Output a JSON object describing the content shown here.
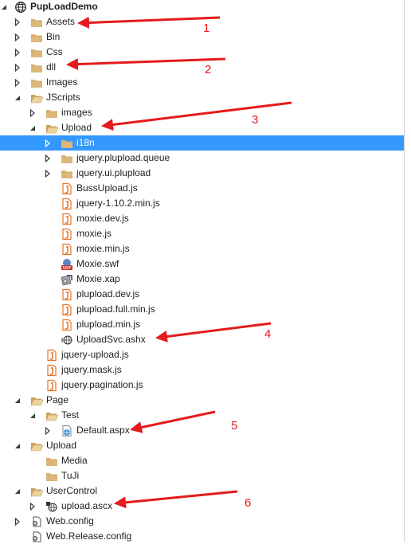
{
  "tree": {
    "items": [
      {
        "label": "PupLoadDemo",
        "depth": 0,
        "expander": "expanded",
        "icon": "web-project-icon",
        "bold": true
      },
      {
        "label": "Assets",
        "depth": 1,
        "expander": "collapsed",
        "icon": "folder-icon"
      },
      {
        "label": "Bin",
        "depth": 1,
        "expander": "collapsed",
        "icon": "folder-icon"
      },
      {
        "label": "Css",
        "depth": 1,
        "expander": "collapsed",
        "icon": "folder-icon"
      },
      {
        "label": "dll",
        "depth": 1,
        "expander": "collapsed",
        "icon": "folder-icon"
      },
      {
        "label": "Images",
        "depth": 1,
        "expander": "collapsed",
        "icon": "folder-icon"
      },
      {
        "label": "JScripts",
        "depth": 1,
        "expander": "expanded",
        "icon": "folder-open-icon"
      },
      {
        "label": "images",
        "depth": 2,
        "expander": "collapsed",
        "icon": "folder-icon"
      },
      {
        "label": "Upload",
        "depth": 2,
        "expander": "expanded",
        "icon": "folder-open-icon"
      },
      {
        "label": "i18n",
        "depth": 3,
        "expander": "collapsed",
        "icon": "folder-icon",
        "selected": true
      },
      {
        "label": "jquery.plupload.queue",
        "depth": 3,
        "expander": "collapsed",
        "icon": "folder-icon"
      },
      {
        "label": "jquery.ui.plupload",
        "depth": 3,
        "expander": "collapsed",
        "icon": "folder-icon"
      },
      {
        "label": "BussUpload.js",
        "depth": 3,
        "expander": "none",
        "icon": "js-file-icon"
      },
      {
        "label": "jquery-1.10.2.min.js",
        "depth": 3,
        "expander": "none",
        "icon": "js-file-icon"
      },
      {
        "label": "moxie.dev.js",
        "depth": 3,
        "expander": "none",
        "icon": "js-file-icon"
      },
      {
        "label": "moxie.js",
        "depth": 3,
        "expander": "none",
        "icon": "js-file-icon"
      },
      {
        "label": "moxie.min.js",
        "depth": 3,
        "expander": "none",
        "icon": "js-file-icon"
      },
      {
        "label": "Moxie.swf",
        "depth": 3,
        "expander": "none",
        "icon": "swf-file-icon"
      },
      {
        "label": "Moxie.xap",
        "depth": 3,
        "expander": "none",
        "icon": "xap-file-icon"
      },
      {
        "label": "plupload.dev.js",
        "depth": 3,
        "expander": "none",
        "icon": "js-file-icon"
      },
      {
        "label": "plupload.full.min.js",
        "depth": 3,
        "expander": "none",
        "icon": "js-file-icon"
      },
      {
        "label": "plupload.min.js",
        "depth": 3,
        "expander": "none",
        "icon": "js-file-icon"
      },
      {
        "label": "UploadSvc.ashx",
        "depth": 3,
        "expander": "none",
        "icon": "ashx-file-icon"
      },
      {
        "label": "jquery-upload.js",
        "depth": 2,
        "expander": "none",
        "icon": "js-file-icon"
      },
      {
        "label": "jquery.mask.js",
        "depth": 2,
        "expander": "none",
        "icon": "js-file-icon"
      },
      {
        "label": "jquery.pagination.js",
        "depth": 2,
        "expander": "none",
        "icon": "js-file-icon"
      },
      {
        "label": "Page",
        "depth": 1,
        "expander": "expanded",
        "icon": "folder-open-icon"
      },
      {
        "label": "Test",
        "depth": 2,
        "expander": "expanded",
        "icon": "folder-open-icon"
      },
      {
        "label": "Default.aspx",
        "depth": 3,
        "expander": "collapsed",
        "icon": "aspx-file-icon"
      },
      {
        "label": "Upload",
        "depth": 1,
        "expander": "expanded",
        "icon": "folder-open-icon"
      },
      {
        "label": "Media",
        "depth": 2,
        "expander": "none",
        "icon": "folder-icon"
      },
      {
        "label": "TuJi",
        "depth": 2,
        "expander": "none",
        "icon": "folder-icon"
      },
      {
        "label": "UserControl",
        "depth": 1,
        "expander": "expanded",
        "icon": "folder-open-icon"
      },
      {
        "label": "upload.ascx",
        "depth": 2,
        "expander": "collapsed",
        "icon": "ascx-file-icon"
      },
      {
        "label": "Web.config",
        "depth": 1,
        "expander": "collapsed",
        "icon": "config-file-icon"
      },
      {
        "label": "Web.Release.config",
        "depth": 1,
        "expander": "none",
        "icon": "config-file-icon"
      }
    ]
  },
  "annotations": [
    {
      "number": "1",
      "target": "Assets"
    },
    {
      "number": "2",
      "target": "dll"
    },
    {
      "number": "3",
      "target": "Upload"
    },
    {
      "number": "4",
      "target": "UploadSvc.ashx"
    },
    {
      "number": "5",
      "target": "Default.aspx"
    },
    {
      "number": "6",
      "target": "upload.ascx"
    }
  ],
  "colors": {
    "selection": "#3399ff",
    "folder": "#dcb67a",
    "js_icon": "#e5752a",
    "arrow": "#e41a1c",
    "text": "#1e1e1e"
  }
}
